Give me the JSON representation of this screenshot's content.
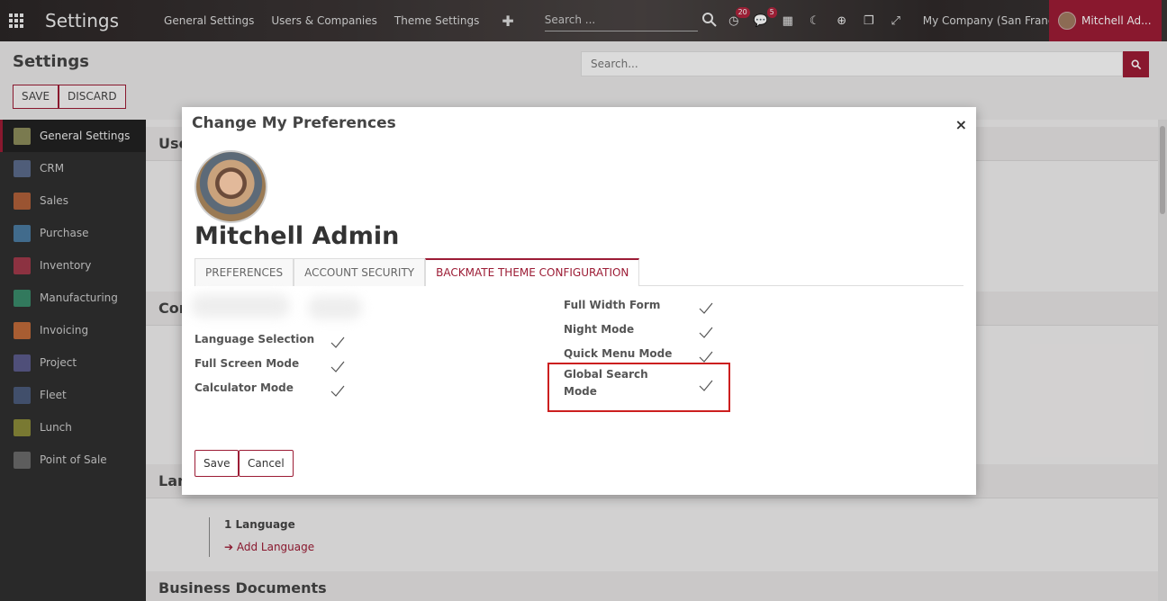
{
  "navbar": {
    "brand": "Settings",
    "menu": [
      "General Settings",
      "Users & Companies",
      "Theme Settings"
    ],
    "plus": "✚",
    "search_placeholder": "Search ...",
    "activity_badge": "20",
    "messages_badge": "5",
    "company": "My Company (San Francisco)",
    "user": "Mitchell Ad..."
  },
  "control": {
    "title": "Settings",
    "save_label": "SAVE",
    "discard_label": "DISCARD",
    "search_placeholder": "Search..."
  },
  "sidebar": {
    "items": [
      {
        "label": "General Settings",
        "color": "#8b8b5a"
      },
      {
        "label": "CRM",
        "color": "#5a6a8a"
      },
      {
        "label": "Sales",
        "color": "#b0603a"
      },
      {
        "label": "Purchase",
        "color": "#4a7aa0"
      },
      {
        "label": "Inventory",
        "color": "#a03a4a"
      },
      {
        "label": "Manufacturing",
        "color": "#3a8a6a"
      },
      {
        "label": "Invoicing",
        "color": "#c06a3a"
      },
      {
        "label": "Project",
        "color": "#5a5a8a"
      },
      {
        "label": "Fleet",
        "color": "#4a5a7a"
      },
      {
        "label": "Lunch",
        "color": "#8a8a3a"
      },
      {
        "label": "Point of Sale",
        "color": "#6a6a6a"
      }
    ]
  },
  "content": {
    "section_users": "Use",
    "section_companies": "Con",
    "section_languages": "Lan",
    "section_business": "Business Documents",
    "language_count": "1 Language",
    "add_language": "➔ Add Language"
  },
  "modal": {
    "title": "Change My Preferences",
    "close": "×",
    "user_name": "Mitchell Admin",
    "tabs": [
      "PREFERENCES",
      "ACCOUNT SECURITY",
      "BACKMATE THEME CONFIGURATION"
    ],
    "left_options": [
      "Language Selection",
      "Full Screen Mode",
      "Calculator Mode"
    ],
    "right_options": [
      "Full Width Form",
      "Night Mode",
      "Quick Menu Mode"
    ],
    "global_search_line1": "Global Search",
    "global_search_line2": "Mode",
    "save_label": "Save",
    "cancel_label": "Cancel"
  },
  "colors": {
    "accent": "#9c1c35",
    "highlight": "#cc1f1f"
  }
}
